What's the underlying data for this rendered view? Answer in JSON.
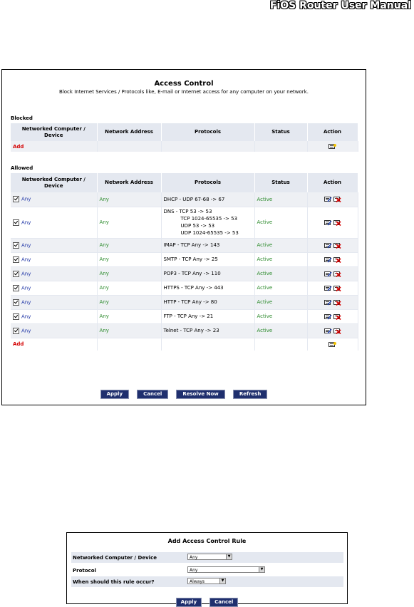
{
  "header": {
    "manual_title": "FiOS Router User Manual"
  },
  "access_control": {
    "title": "Access Control",
    "subtitle": "Block Internet Services / Protocols like, E-mail or Internet access for any computer on your network.",
    "columns": [
      "Networked Computer / Device",
      "Network Address",
      "Protocols",
      "Status",
      "Action"
    ],
    "blocked": {
      "label": "Blocked",
      "add_label": "Add"
    },
    "allowed": {
      "label": "Allowed",
      "add_label": "Add",
      "rows": [
        {
          "device": "Any",
          "address": "Any",
          "protocol": [
            "DHCP - UDP 67-68 -> 67"
          ],
          "status": "Active"
        },
        {
          "device": "Any",
          "address": "Any",
          "protocol": [
            "DNS - TCP 53 -> 53",
            "TCP 1024-65535 -> 53",
            "UDP 53 -> 53",
            "UDP 1024-65535 -> 53"
          ],
          "status": "Active"
        },
        {
          "device": "Any",
          "address": "Any",
          "protocol": [
            "IMAP - TCP Any -> 143"
          ],
          "status": "Active"
        },
        {
          "device": "Any",
          "address": "Any",
          "protocol": [
            "SMTP - TCP Any -> 25"
          ],
          "status": "Active"
        },
        {
          "device": "Any",
          "address": "Any",
          "protocol": [
            "POP3 - TCP Any -> 110"
          ],
          "status": "Active"
        },
        {
          "device": "Any",
          "address": "Any",
          "protocol": [
            "HTTPS - TCP Any -> 443"
          ],
          "status": "Active"
        },
        {
          "device": "Any",
          "address": "Any",
          "protocol": [
            "HTTP - TCP Any -> 80"
          ],
          "status": "Active"
        },
        {
          "device": "Any",
          "address": "Any",
          "protocol": [
            "FTP - TCP Any -> 21"
          ],
          "status": "Active"
        },
        {
          "device": "Any",
          "address": "Any",
          "protocol": [
            "Telnet - TCP Any -> 23"
          ],
          "status": "Active"
        }
      ]
    },
    "buttons": {
      "apply": "Apply",
      "cancel": "Cancel",
      "resolve_now": "Resolve Now",
      "refresh": "Refresh"
    },
    "colors": {
      "header_bg": "#e4e8f0",
      "button_bg": "#1f2f6e",
      "active": "#2b8a2b",
      "add": "#d40000",
      "link": "#1f35a6"
    }
  },
  "add_rule": {
    "title": "Add Access Control Rule",
    "device_label": "Networked Computer / Device",
    "device_value": "Any",
    "protocol_label": "Protocol",
    "protocol_value": "Any",
    "when_label": "When should this rule occur?",
    "when_value": "Always",
    "apply": "Apply",
    "cancel": "Cancel"
  }
}
